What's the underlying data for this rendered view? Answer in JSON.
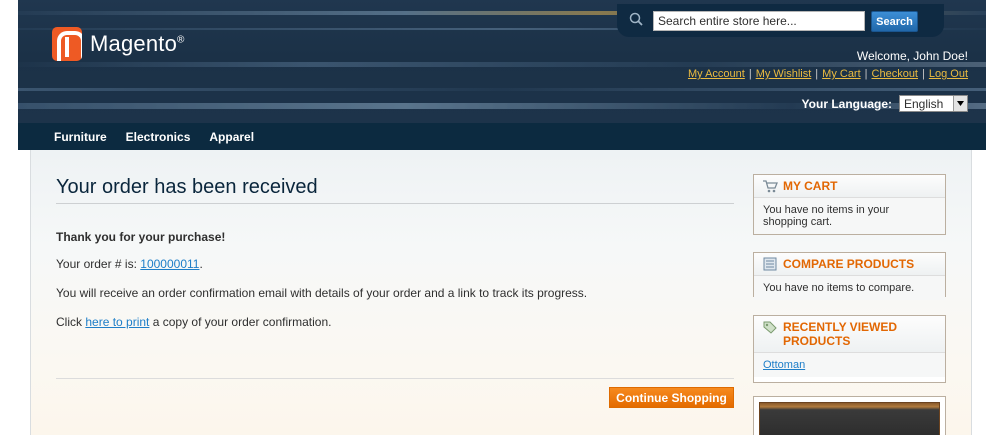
{
  "header": {
    "logo_text": "Magento",
    "logo_reg": "®",
    "search_placeholder": "Search entire store here...",
    "search_button": "Search",
    "welcome": "Welcome, John Doe!",
    "links": [
      "My Account",
      "My Wishlist",
      "My Cart",
      "Checkout",
      "Log Out"
    ],
    "language_label": "Your Language:",
    "language_value": "English"
  },
  "nav": [
    "Furniture",
    "Electronics",
    "Apparel"
  ],
  "main": {
    "title": "Your order has been received",
    "thanks": "Thank you for your purchase!",
    "order_prefix": "Your order # is: ",
    "order_number": "100000011",
    "order_suffix": ".",
    "email_text": "You will receive an order confirmation email with details of your order and a link to track its progress.",
    "print_prefix": "Click ",
    "print_link": "here to print",
    "print_suffix": " a copy of your order confirmation.",
    "continue_button": "Continue Shopping"
  },
  "sidebar": {
    "cart": {
      "title": "MY CART",
      "body": "You have no items in your shopping cart."
    },
    "compare": {
      "title": "COMPARE PRODUCTS",
      "body": "You have no items to compare."
    },
    "recent": {
      "title": "RECENTLY VIEWED PRODUCTS",
      "item": "Ottoman"
    }
  },
  "colors": {
    "header_bg": "#1b3147",
    "nav_bg": "#0c2a40",
    "link": "#1e7ec8",
    "header_link": "#ebbb40",
    "accent_orange": "#e26703",
    "button_orange": "#f18200"
  }
}
